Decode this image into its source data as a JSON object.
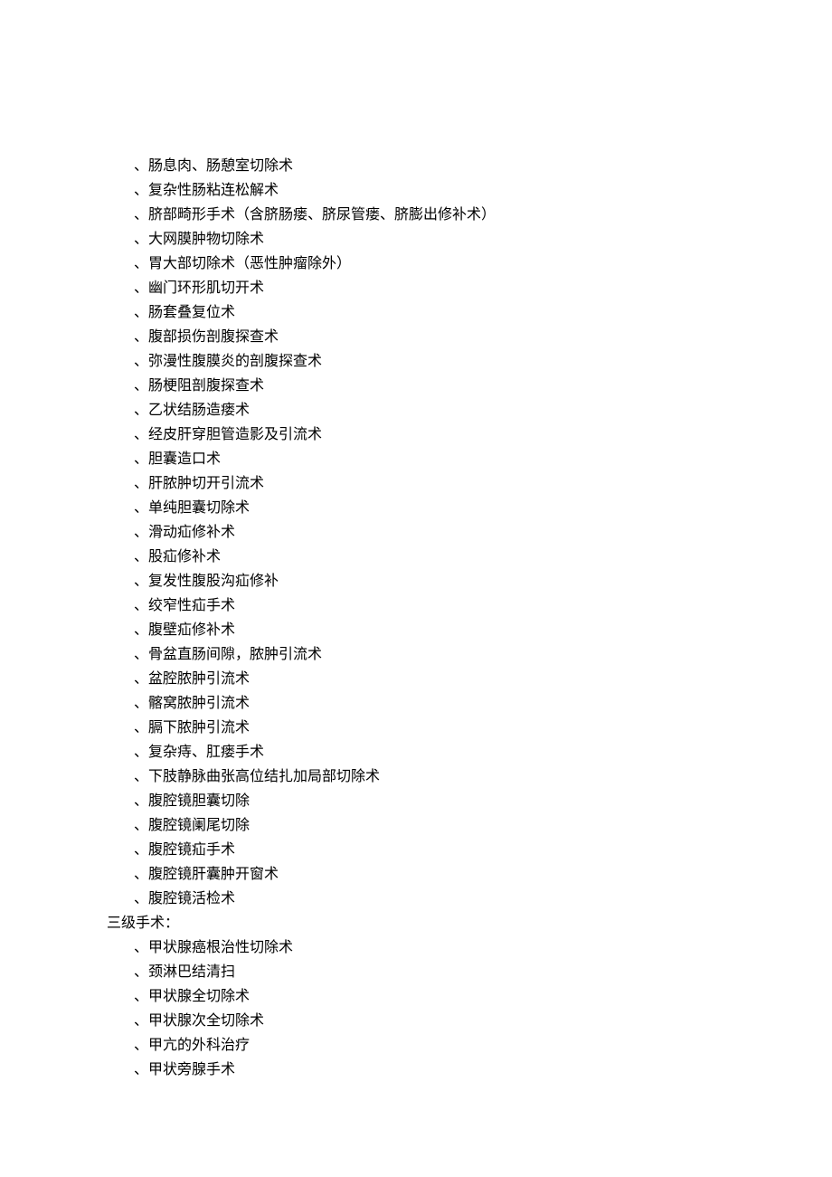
{
  "list1": [
    "、肠息肉、肠憩室切除术",
    "、复杂性肠粘连松解术",
    "、脐部畸形手术（含脐肠瘘、脐尿管瘘、脐膨出修补术）",
    "、大网膜肿物切除术",
    "、胃大部切除术（恶性肿瘤除外）",
    "、幽门环形肌切开术",
    "、肠套叠复位术",
    "、腹部损伤剖腹探查术",
    "、弥漫性腹膜炎的剖腹探查术",
    "、肠梗阻剖腹探查术",
    "、乙状结肠造瘘术",
    "、经皮肝穿胆管造影及引流术",
    "、胆囊造口术",
    "、肝脓肿切开引流术",
    "、单纯胆囊切除术",
    "、滑动疝修补术",
    "、股疝修补术",
    "、复发性腹股沟疝修补",
    "、绞窄性疝手术",
    "、腹壁疝修补术",
    "、骨盆直肠间隙，脓肿引流术",
    "、盆腔脓肿引流术",
    "、髂窝脓肿引流术",
    "、膈下脓肿引流术",
    "、复杂痔、肛瘘手术",
    "、下肢静脉曲张高位结扎加局部切除术",
    "、腹腔镜胆囊切除",
    "、腹腔镜阑尾切除",
    "、腹腔镜疝手术",
    "、腹腔镜肝囊肿开窗术",
    "、腹腔镜活检术"
  ],
  "section_header": "三级手术：",
  "list2": [
    "、甲状腺癌根治性切除术",
    "、颈淋巴结清扫",
    "、甲状腺全切除术",
    "、甲状腺次全切除术",
    "、甲亢的外科治疗",
    "、甲状旁腺手术"
  ]
}
